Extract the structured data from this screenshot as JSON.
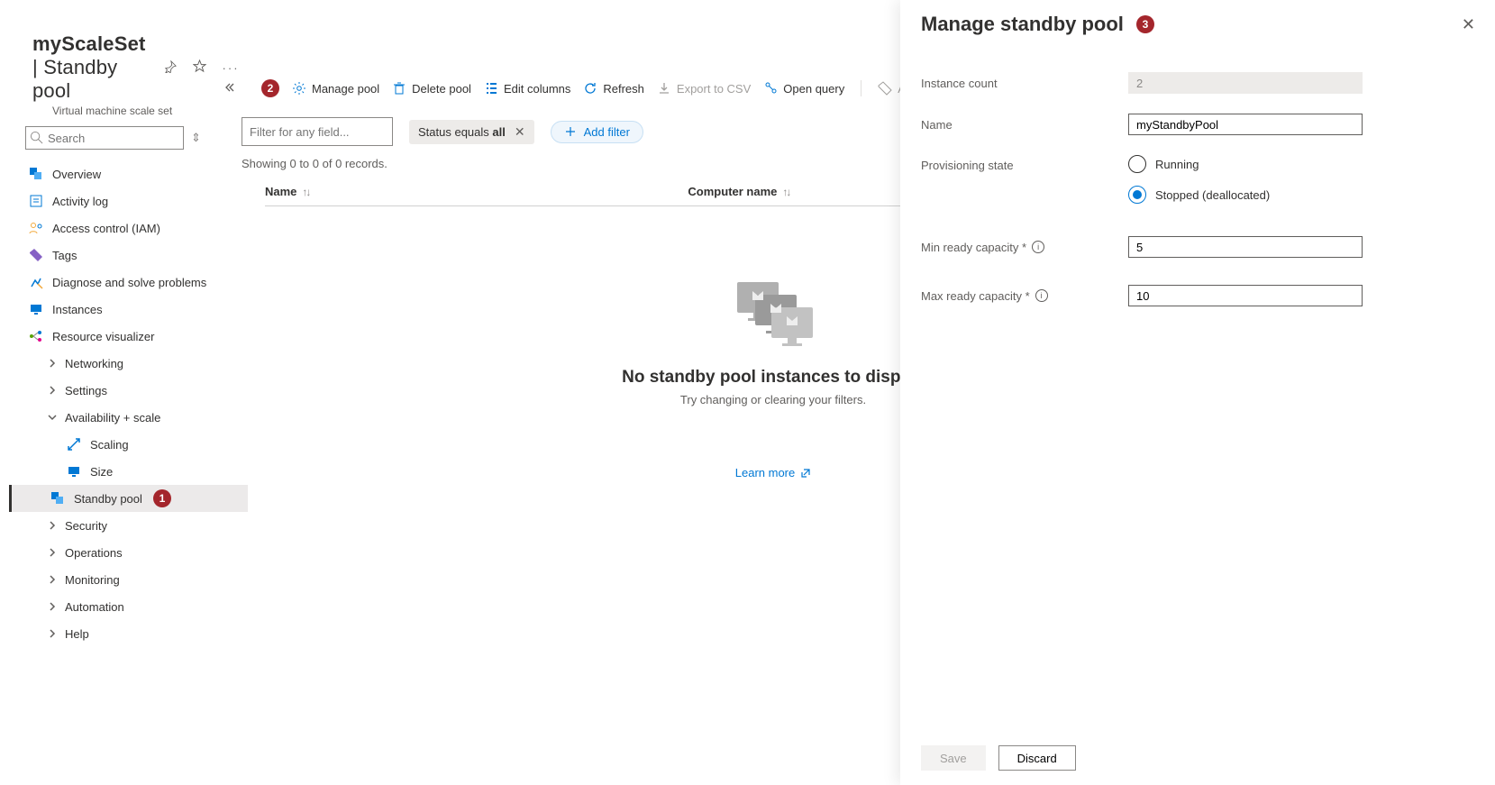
{
  "header": {
    "resource": "myScaleSet",
    "section": "Standby pool",
    "subtype": "Virtual machine scale set"
  },
  "search": {
    "placeholder": "Search"
  },
  "nav": {
    "overview": "Overview",
    "activity": "Activity log",
    "iam": "Access control (IAM)",
    "tags": "Tags",
    "diag": "Diagnose and solve problems",
    "instances": "Instances",
    "resvis": "Resource visualizer",
    "networking": "Networking",
    "settings": "Settings",
    "avail": "Availability + scale",
    "scaling": "Scaling",
    "size": "Size",
    "standby": "Standby pool",
    "security": "Security",
    "ops": "Operations",
    "monitoring": "Monitoring",
    "automation": "Automation",
    "help": "Help"
  },
  "callouts": {
    "one": "1",
    "two": "2",
    "three": "3"
  },
  "toolbar": {
    "manage": "Manage pool",
    "delete": "Delete pool",
    "edit": "Edit columns",
    "refresh": "Refresh",
    "export": "Export to CSV",
    "query": "Open query",
    "assign": "Assign tags"
  },
  "filter": {
    "placeholder": "Filter for any field...",
    "chip_prefix": "Status equals ",
    "chip_value": "all",
    "add": "Add filter"
  },
  "records": "Showing 0 to 0 of 0 records.",
  "columns": {
    "name": "Name",
    "computer": "Computer name"
  },
  "empty": {
    "title": "No standby pool instances to display",
    "sub": "Try changing or clearing your filters.",
    "learn": "Learn more"
  },
  "panel": {
    "title": "Manage standby pool",
    "instance_count_lbl": "Instance count",
    "instance_count_val": "2",
    "name_lbl": "Name",
    "name_val": "myStandbyPool",
    "prov_lbl": "Provisioning state",
    "running": "Running",
    "stopped": "Stopped (deallocated)",
    "min_lbl": "Min ready capacity *",
    "min_val": "5",
    "max_lbl": "Max ready capacity *",
    "max_val": "10",
    "save": "Save",
    "discard": "Discard"
  }
}
